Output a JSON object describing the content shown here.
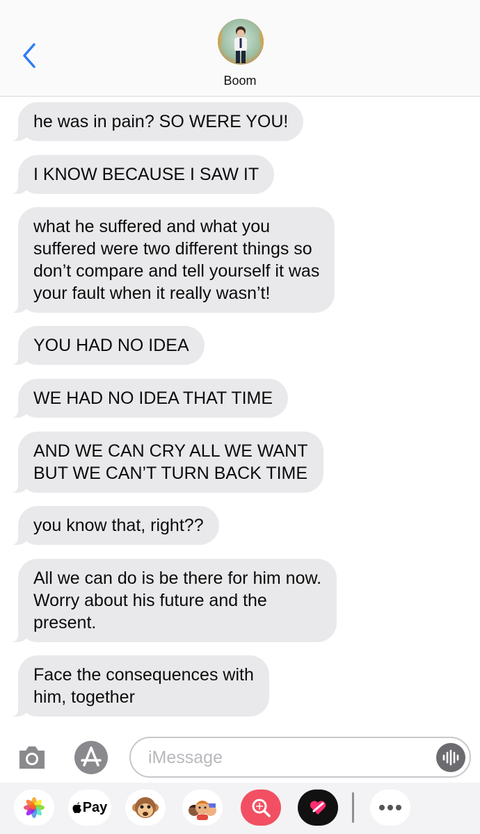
{
  "header": {
    "contact_name": "Boom"
  },
  "messages": [
    {
      "text": "he was in pain? SO WERE YOU!"
    },
    {
      "text": "I KNOW BECAUSE I SAW IT"
    },
    {
      "text": "what he suffered and what you\nsuffered were two different things so\ndon’t compare and tell yourself it was\nyour fault when it really wasn’t!"
    },
    {
      "text": "YOU HAD NO IDEA"
    },
    {
      "text": "WE HAD NO IDEA THAT TIME"
    },
    {
      "text": "AND WE CAN CRY ALL WE WANT\nBUT WE CAN’T TURN BACK TIME"
    },
    {
      "text": "you know that, right??"
    },
    {
      "text": "All we can do is be there for him now.\nWorry about his future and the\npresent."
    },
    {
      "text": "Face the consequences with\nhim, together"
    }
  ],
  "composer": {
    "placeholder": "iMessage",
    "value": ""
  },
  "app_drawer": {
    "apple_pay_label": "Pay"
  },
  "colors": {
    "accent": "#2f7cf6",
    "bubble_incoming": "#e9e9eb",
    "header_bg": "#fafafa",
    "drawer_bg": "#f3f3f5"
  },
  "icons": [
    "back-chevron-icon",
    "camera-icon",
    "app-store-icon",
    "audio-wave-icon",
    "photos-icon",
    "apple-pay-icon",
    "animoji-icon",
    "memoji-icon",
    "image-search-icon",
    "digital-touch-icon",
    "more-icon"
  ]
}
